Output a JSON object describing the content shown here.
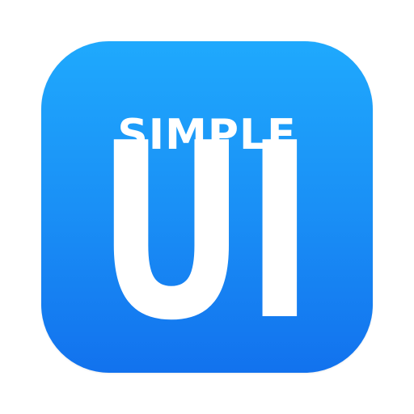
{
  "icon": {
    "line1": "SIMPLE",
    "line2": "UI",
    "colors": {
      "gradient_top": "#1fa9fd",
      "gradient_bottom": "#1272ee",
      "text": "#ffffff"
    }
  }
}
